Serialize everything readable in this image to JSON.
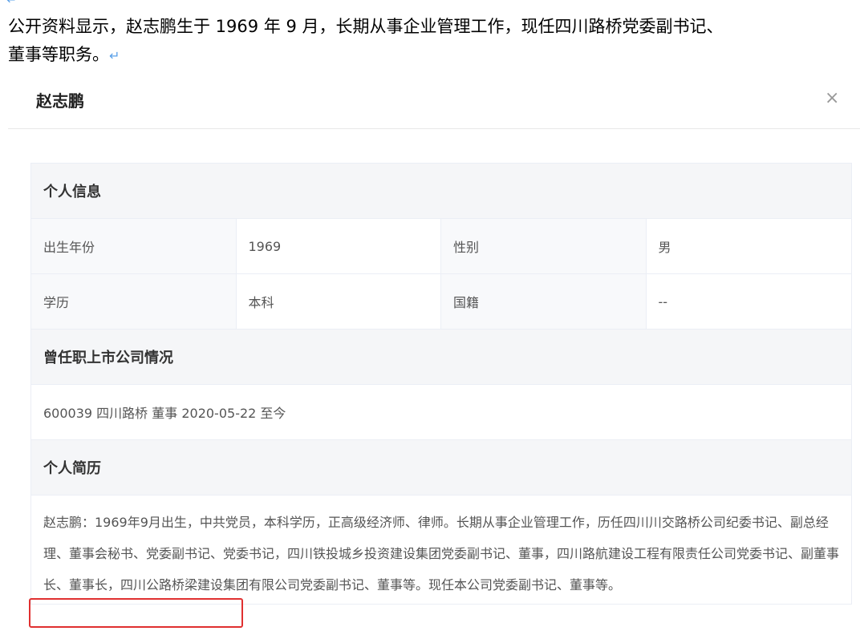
{
  "intro": {
    "text": "公开资料显示，赵志鹏生于 1969 年 9 月，长期从事企业管理工作，现任四川路桥党委副书记、董事等职务。",
    "return_mark": "↵"
  },
  "modal": {
    "title": "赵志鹏",
    "close": "×"
  },
  "personal": {
    "heading": "个人信息",
    "rows": [
      [
        {
          "k": "出生年份",
          "v": "1969"
        },
        {
          "k": "性别",
          "v": "男"
        }
      ],
      [
        {
          "k": "学历",
          "v": "本科"
        },
        {
          "k": "国籍",
          "v": "--"
        }
      ]
    ]
  },
  "history": {
    "heading": "曾任职上市公司情况",
    "item": "600039 四川路桥 董事 2020-05-22 至今"
  },
  "resume": {
    "heading": "个人简历",
    "text": "赵志鹏：1969年9月出生，中共党员，本科学历，正高级经济师、律师。长期从事企业管理工作，历任四川川交路桥公司纪委书记、副总经理、董事会秘书、党委副书记、党委书记，四川铁投城乡投资建设集团党委副书记、董事，四川路航建设工程有限责任公司党委书记、副董事长、董事长，四川公路桥梁建设集团有限公司党委副书记、董事等。现任本公司党委副书记、董事等。"
  },
  "colors": {
    "highlight": "#e03030"
  }
}
